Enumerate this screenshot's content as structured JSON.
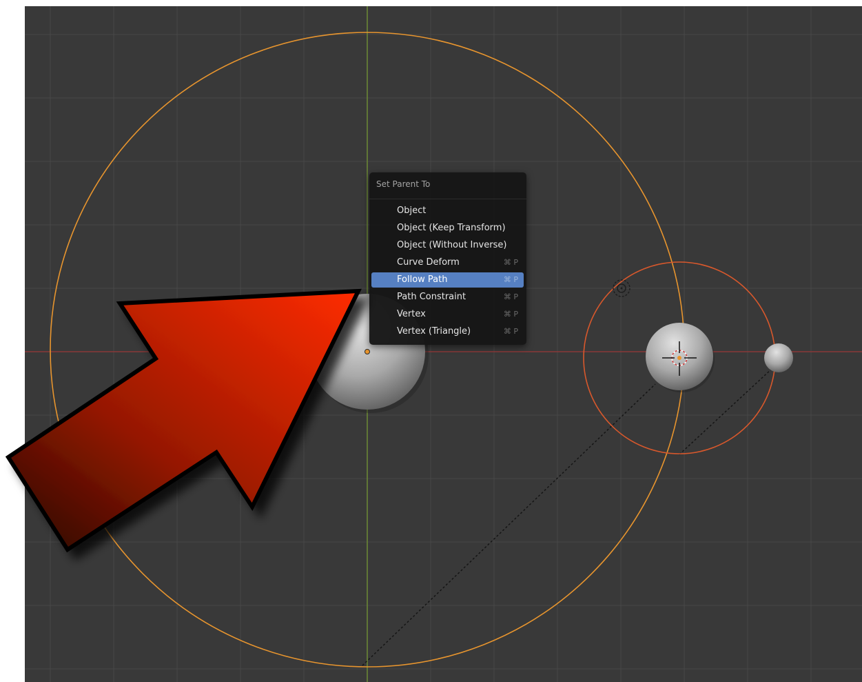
{
  "menu": {
    "title": "Set Parent To",
    "items": [
      {
        "label": "Object",
        "shortcut": "",
        "active": false
      },
      {
        "label": "Object (Keep Transform)",
        "shortcut": "",
        "active": false
      },
      {
        "label": "Object (Without Inverse)",
        "shortcut": "",
        "active": false
      },
      {
        "label": "Curve Deform",
        "shortcut": "⌘ P",
        "active": false
      },
      {
        "label": "Follow Path",
        "shortcut": "⌘ P",
        "active": true
      },
      {
        "label": "Path Constraint",
        "shortcut": "⌘ P",
        "active": false
      },
      {
        "label": "Vertex",
        "shortcut": "⌘ P",
        "active": false
      },
      {
        "label": "Vertex (Triangle)",
        "shortcut": "⌘ P",
        "active": false
      }
    ]
  },
  "colors": {
    "viewport_bg": "#393939",
    "grid": "#474747",
    "x_axis": "#8b3838",
    "y_axis": "#6d8a36",
    "orbit_selected": "#e8952e",
    "orbit_secondary": "#d8582c",
    "menu_highlight": "#5680c2",
    "arrow_red": "#f22a00"
  }
}
